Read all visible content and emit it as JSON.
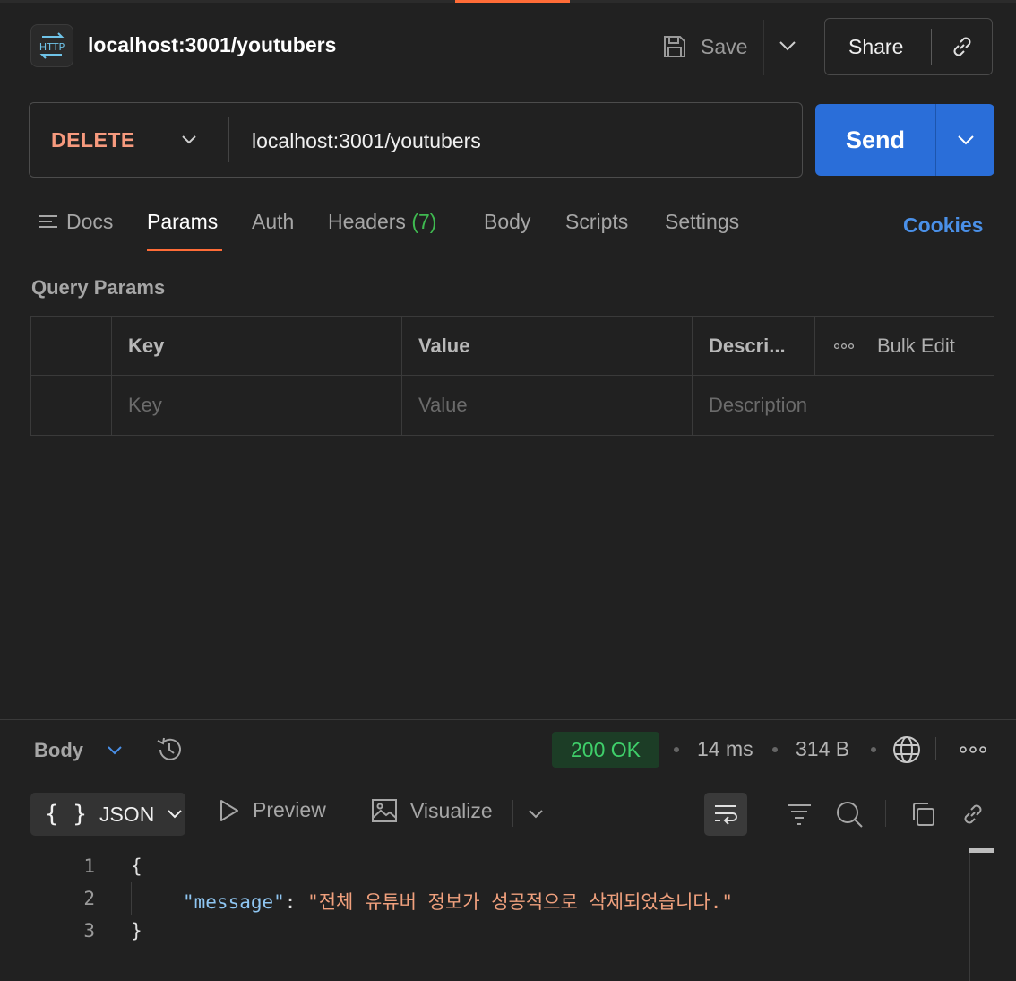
{
  "header": {
    "badge_text": "HTTP",
    "title": "localhost:3001/youtubers",
    "save_label": "Save",
    "share_label": "Share"
  },
  "request": {
    "method": "DELETE",
    "url": "localhost:3001/youtubers",
    "send_label": "Send"
  },
  "tabs": {
    "docs": "Docs",
    "params": "Params",
    "auth": "Auth",
    "headers": "Headers",
    "headers_count": "(7)",
    "body": "Body",
    "scripts": "Scripts",
    "settings": "Settings",
    "cookies": "Cookies",
    "active": "Params"
  },
  "query_params": {
    "title": "Query Params",
    "columns": {
      "key": "Key",
      "value": "Value",
      "description": "Descri..."
    },
    "bulk_edit": "Bulk Edit",
    "placeholders": {
      "key": "Key",
      "value": "Value",
      "description": "Description"
    }
  },
  "response": {
    "section_label": "Body",
    "status": "200 OK",
    "time": "14 ms",
    "size": "314 B",
    "format": "JSON",
    "format_braces": "{ }",
    "preview_label": "Preview",
    "visualize_label": "Visualize",
    "lines": [
      {
        "num": "1",
        "text": "{"
      },
      {
        "num": "2",
        "key": "\"message\"",
        "colon": ": ",
        "value": "\"전체 유튜버 정보가 성공적으로 삭제되었습니다.\""
      },
      {
        "num": "3",
        "text": "}"
      }
    ]
  },
  "colors": {
    "accent": "#ff6c37",
    "send": "#2a6ed9",
    "method": "#f79a7e",
    "status_ok": "#3fcf6a",
    "link": "#4a90e8"
  }
}
